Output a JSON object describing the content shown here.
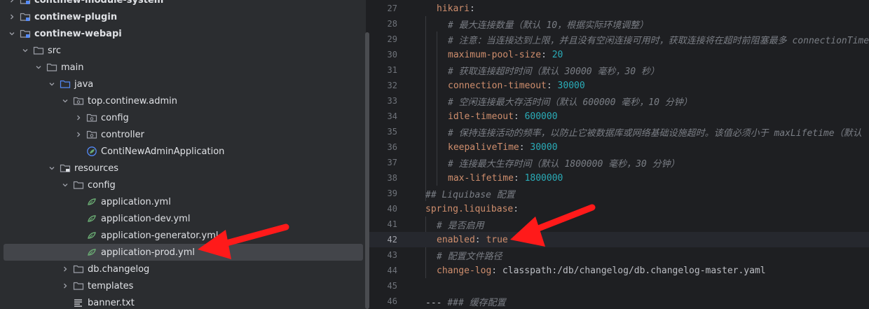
{
  "tree": {
    "items": [
      {
        "label": "continew-module-system",
        "indent": 1,
        "chevron": "right",
        "icon": "module",
        "bold": true
      },
      {
        "label": "continew-plugin",
        "indent": 1,
        "chevron": "right",
        "icon": "module",
        "bold": true
      },
      {
        "label": "continew-webapi",
        "indent": 1,
        "chevron": "down",
        "icon": "module",
        "bold": true
      },
      {
        "label": "src",
        "indent": 2,
        "chevron": "down",
        "icon": "folder"
      },
      {
        "label": "main",
        "indent": 3,
        "chevron": "down",
        "icon": "folder"
      },
      {
        "label": "java",
        "indent": 4,
        "chevron": "down",
        "icon": "folder-source"
      },
      {
        "label": "top.continew.admin",
        "indent": 5,
        "chevron": "down",
        "icon": "package"
      },
      {
        "label": "config",
        "indent": 6,
        "chevron": "right",
        "icon": "package"
      },
      {
        "label": "controller",
        "indent": 6,
        "chevron": "right",
        "icon": "package"
      },
      {
        "label": "ContiNewAdminApplication",
        "indent": 6,
        "chevron": "",
        "icon": "spring-class"
      },
      {
        "label": "resources",
        "indent": 4,
        "chevron": "down",
        "icon": "folder-resources"
      },
      {
        "label": "config",
        "indent": 5,
        "chevron": "down",
        "icon": "folder"
      },
      {
        "label": "application.yml",
        "indent": 6,
        "chevron": "",
        "icon": "spring-yml"
      },
      {
        "label": "application-dev.yml",
        "indent": 6,
        "chevron": "",
        "icon": "spring-yml"
      },
      {
        "label": "application-generator.yml",
        "indent": 6,
        "chevron": "",
        "icon": "spring-yml"
      },
      {
        "label": "application-prod.yml",
        "indent": 6,
        "chevron": "",
        "icon": "spring-yml",
        "selected": true
      },
      {
        "label": "db.changelog",
        "indent": 5,
        "chevron": "right",
        "icon": "folder"
      },
      {
        "label": "templates",
        "indent": 5,
        "chevron": "right",
        "icon": "folder"
      },
      {
        "label": "banner.txt",
        "indent": 5,
        "chevron": "",
        "icon": "text-file"
      }
    ]
  },
  "editor": {
    "lines": [
      {
        "n": "27",
        "indent": 1,
        "parts": [
          [
            "key",
            "hikari"
          ],
          [
            "str",
            ":"
          ]
        ]
      },
      {
        "n": "28",
        "indent": 2,
        "parts": [
          [
            "comment",
            "# 最大连接数量（默认 10，根据实际环境调整）"
          ]
        ]
      },
      {
        "n": "29",
        "indent": 2,
        "parts": [
          [
            "comment",
            "# 注意：当连接达到上限，并且没有空闲连接可用时，获取连接将在超时前阻塞最多 connectionTimeout"
          ]
        ]
      },
      {
        "n": "30",
        "indent": 2,
        "parts": [
          [
            "key",
            "maximum-pool-size"
          ],
          [
            "str",
            ": "
          ],
          [
            "val",
            "20"
          ]
        ]
      },
      {
        "n": "31",
        "indent": 2,
        "parts": [
          [
            "comment",
            "# 获取连接超时时间（默认 30000 毫秒，30 秒）"
          ]
        ]
      },
      {
        "n": "32",
        "indent": 2,
        "parts": [
          [
            "key",
            "connection-timeout"
          ],
          [
            "str",
            ": "
          ],
          [
            "val",
            "30000"
          ]
        ]
      },
      {
        "n": "33",
        "indent": 2,
        "parts": [
          [
            "comment",
            "# 空闲连接最大存活时间（默认 600000 毫秒，10 分钟）"
          ]
        ]
      },
      {
        "n": "34",
        "indent": 2,
        "parts": [
          [
            "key",
            "idle-timeout"
          ],
          [
            "str",
            ": "
          ],
          [
            "val",
            "600000"
          ]
        ]
      },
      {
        "n": "35",
        "indent": 2,
        "parts": [
          [
            "comment",
            "# 保持连接活动的频率，以防止它被数据库或网络基础设施超时。该值必须小于 maxLifetime（默认"
          ]
        ]
      },
      {
        "n": "36",
        "indent": 2,
        "parts": [
          [
            "key",
            "keepaliveTime"
          ],
          [
            "str",
            ": "
          ],
          [
            "val",
            "30000"
          ]
        ]
      },
      {
        "n": "37",
        "indent": 2,
        "parts": [
          [
            "comment",
            "# 连接最大生存时间（默认 1800000 毫秒，30 分钟）"
          ]
        ]
      },
      {
        "n": "38",
        "indent": 2,
        "parts": [
          [
            "key",
            "max-lifetime"
          ],
          [
            "str",
            ": "
          ],
          [
            "val",
            "1800000"
          ]
        ]
      },
      {
        "n": "39",
        "indent": 0,
        "parts": [
          [
            "comment",
            "## Liquibase 配置"
          ]
        ]
      },
      {
        "n": "40",
        "indent": 0,
        "parts": [
          [
            "key",
            "spring.liquibase"
          ],
          [
            "str",
            ":"
          ]
        ]
      },
      {
        "n": "41",
        "indent": 1,
        "parts": [
          [
            "comment",
            "# 是否启用"
          ]
        ]
      },
      {
        "n": "42",
        "indent": 1,
        "parts": [
          [
            "key",
            "enabled"
          ],
          [
            "str",
            ": "
          ],
          [
            "bool",
            "true"
          ]
        ],
        "current": true
      },
      {
        "n": "43",
        "indent": 1,
        "parts": [
          [
            "comment",
            "# 配置文件路径"
          ]
        ]
      },
      {
        "n": "44",
        "indent": 1,
        "parts": [
          [
            "key",
            "change-log"
          ],
          [
            "str",
            ": classpath:/db/changelog/db.changelog-master.yaml"
          ]
        ]
      },
      {
        "n": "45",
        "indent": 0,
        "parts": []
      },
      {
        "n": "46",
        "indent": 0,
        "parts": [
          [
            "str",
            "--- "
          ],
          [
            "comment",
            "### 缓存配置"
          ]
        ]
      }
    ]
  },
  "colors": {
    "annotation_arrow": "#ff1a1a",
    "folder": "#9da0a8",
    "spring": "#6aab73",
    "source_folder": "#548af7"
  }
}
